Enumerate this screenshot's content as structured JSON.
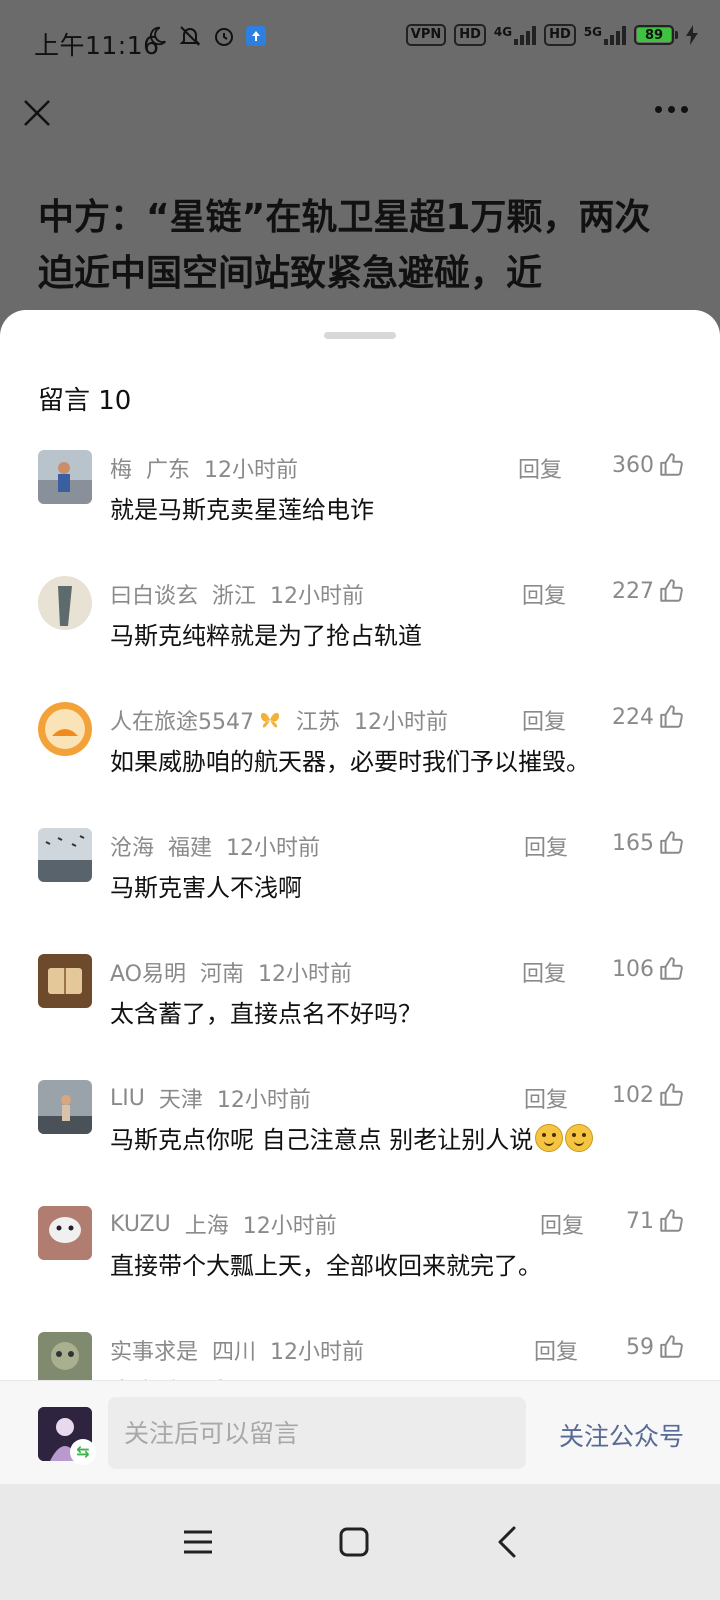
{
  "status": {
    "time": "上午11:16",
    "vpn": "VPN",
    "hd1": "HD",
    "net1": "4G",
    "hd2": "HD",
    "net2": "5G",
    "battery": "89"
  },
  "article": {
    "title": "中方：“星链”在轨卫星超1万颗，两次迫近中国空间站致紧急避碰，近"
  },
  "sheet": {
    "title": "留言 10",
    "reply_label": "回复"
  },
  "comments": [
    {
      "name": "梅",
      "region": "广东",
      "time": "12小时前",
      "likes": "360",
      "text": "就是马斯克卖星莲给电诈"
    },
    {
      "name": "曰白谈玄",
      "region": "浙江",
      "time": "12小时前",
      "likes": "227",
      "text": "马斯克纯粹就是为了抢占轨道"
    },
    {
      "name": "人在旅途5547",
      "region": "江苏",
      "time": "12小时前",
      "likes": "224",
      "text": "如果威胁咱的航天器，必要时我们予以摧毁。"
    },
    {
      "name": "沧海",
      "region": "福建",
      "time": "12小时前",
      "likes": "165",
      "text": "马斯克害人不浅啊"
    },
    {
      "name": "AO易明",
      "region": "河南",
      "time": "12小时前",
      "likes": "106",
      "text": "太含蓄了，直接点名不好吗？"
    },
    {
      "name": "LIU",
      "region": "天津",
      "time": "12小时前",
      "likes": "102",
      "text": "马斯克点你呢 自己注意点 别老让别人说"
    },
    {
      "name": "KUZU",
      "region": "上海",
      "time": "12小时前",
      "likes": "71",
      "text": "直接带个大瓢上天，全部收回来就完了。"
    },
    {
      "name": "实事求是",
      "region": "四川",
      "time": "12小时前",
      "likes": "59",
      "text": "太空垃圾清理"
    }
  ],
  "bottom": {
    "input_placeholder": "关注后可以留言",
    "follow_label": "关注公众号"
  }
}
